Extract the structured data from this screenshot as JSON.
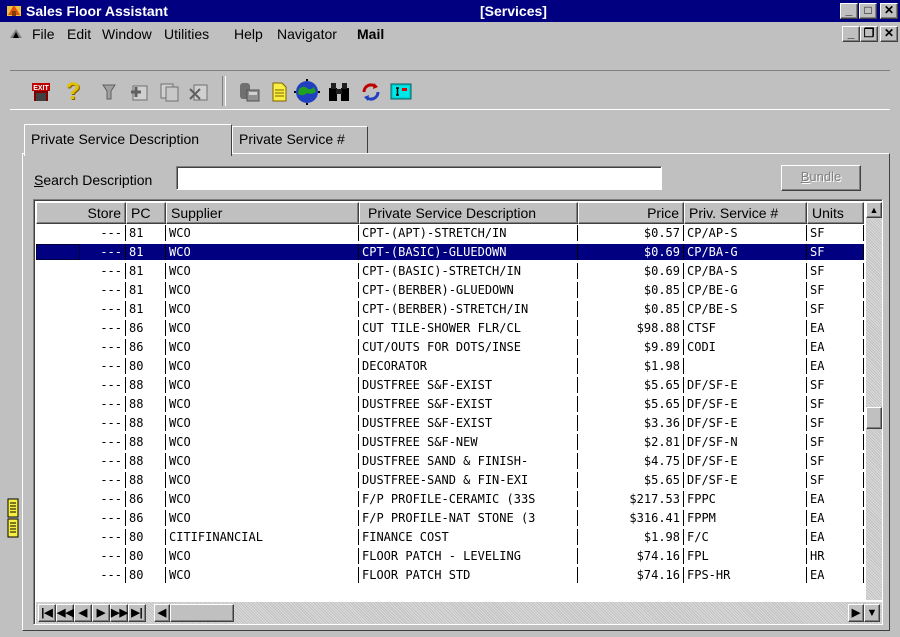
{
  "window": {
    "title": "Sales Floor Assistant",
    "subtitle": "[Services]",
    "minimize": "_",
    "maximize": "□",
    "close": "✕",
    "mdi_minimize": "_",
    "mdi_restore": "❐",
    "mdi_close": "✕"
  },
  "menu": {
    "items": [
      "File",
      "Edit",
      "Window",
      "Utilities",
      "Help",
      "Navigator",
      "Mail"
    ]
  },
  "toolbar": {
    "exit_label": "EXIT",
    "help_label": "?",
    "icons": [
      "exit-icon",
      "help-icon",
      "wand-icon",
      "add-record-icon",
      "copy-record-icon",
      "delete-record-icon",
      "phone-icon",
      "document-icon",
      "globe-icon",
      "binoculars-icon",
      "refresh-icon",
      "terminal-icon"
    ]
  },
  "tabs": [
    {
      "label": "Private Service Description",
      "active": true
    },
    {
      "label": "Private Service #",
      "active": false
    }
  ],
  "search": {
    "label_prefix": "S",
    "label_rest": "earch Description",
    "value": ""
  },
  "bundle": {
    "label_prefix": "B",
    "label_rest": "undle"
  },
  "grid": {
    "columns": [
      "Store",
      "PC",
      "Supplier",
      "Private Service Description",
      "Price",
      "Priv. Service #",
      "Units"
    ],
    "rows": [
      [
        "---",
        "81",
        "WCO",
        "CPT-(APT)-STRETCH/IN",
        "$0.57",
        "CP/AP-S",
        "SF"
      ],
      [
        "---",
        "81",
        "WCO",
        "CPT-(BASIC)-GLUEDOWN",
        "$0.69",
        "CP/BA-G",
        "SF"
      ],
      [
        "---",
        "81",
        "WCO",
        "CPT-(BASIC)-STRETCH/IN",
        "$0.69",
        "CP/BA-S",
        "SF"
      ],
      [
        "---",
        "81",
        "WCO",
        "CPT-(BERBER)-GLUEDOWN",
        "$0.85",
        "CP/BE-G",
        "SF"
      ],
      [
        "---",
        "81",
        "WCO",
        "CPT-(BERBER)-STRETCH/IN",
        "$0.85",
        "CP/BE-S",
        "SF"
      ],
      [
        "---",
        "86",
        "WCO",
        "CUT TILE-SHOWER FLR/CL",
        "$98.88",
        "CTSF",
        "EA"
      ],
      [
        "---",
        "86",
        "WCO",
        "CUT/OUTS FOR DOTS/INSE",
        "$9.89",
        "CODI",
        "EA"
      ],
      [
        "---",
        "80",
        "WCO",
        "DECORATOR",
        "$1.98",
        "",
        "EA"
      ],
      [
        "---",
        "88",
        "WCO",
        "DUSTFREE S&F-EXIST",
        "$5.65",
        "DF/SF-E",
        "SF"
      ],
      [
        "---",
        "88",
        "WCO",
        "DUSTFREE S&F-EXIST",
        "$5.65",
        "DF/SF-E",
        "SF"
      ],
      [
        "---",
        "88",
        "WCO",
        "DUSTFREE S&F-EXIST",
        "$3.36",
        "DF/SF-E",
        "SF"
      ],
      [
        "---",
        "88",
        "WCO",
        "DUSTFREE S&F-NEW",
        "$2.81",
        "DF/SF-N",
        "SF"
      ],
      [
        "---",
        "88",
        "WCO",
        "DUSTFREE SAND & FINISH-",
        "$4.75",
        "DF/SF-E",
        "SF"
      ],
      [
        "---",
        "88",
        "WCO",
        "DUSTFREE-SAND & FIN-EXI",
        "$5.65",
        "DF/SF-E",
        "SF"
      ],
      [
        "---",
        "86",
        "WCO",
        "F/P PROFILE-CERAMIC (33S",
        "$217.53",
        "FPPC",
        "EA"
      ],
      [
        "---",
        "86",
        "WCO",
        "F/P PROFILE-NAT STONE (3",
        "$316.41",
        "FPPM",
        "EA"
      ],
      [
        "---",
        "80",
        "CITIFINANCIAL",
        "FINANCE COST",
        "$1.98",
        "F/C",
        "EA"
      ],
      [
        "---",
        "80",
        "WCO",
        "FLOOR PATCH - LEVELING",
        "$74.16",
        "FPL",
        "HR"
      ],
      [
        "---",
        "80",
        "WCO",
        "FLOOR PATCH STD",
        "$74.16",
        "FPS-HR",
        "EA"
      ]
    ],
    "selected_row": 1
  },
  "navigator": {
    "buttons": [
      "|◀",
      "◀◀",
      "◀",
      "▶",
      "▶▶",
      "▶|"
    ]
  },
  "colors": {
    "selection": "#000080",
    "titlebar": "#000080",
    "face": "#c0c0c0"
  }
}
